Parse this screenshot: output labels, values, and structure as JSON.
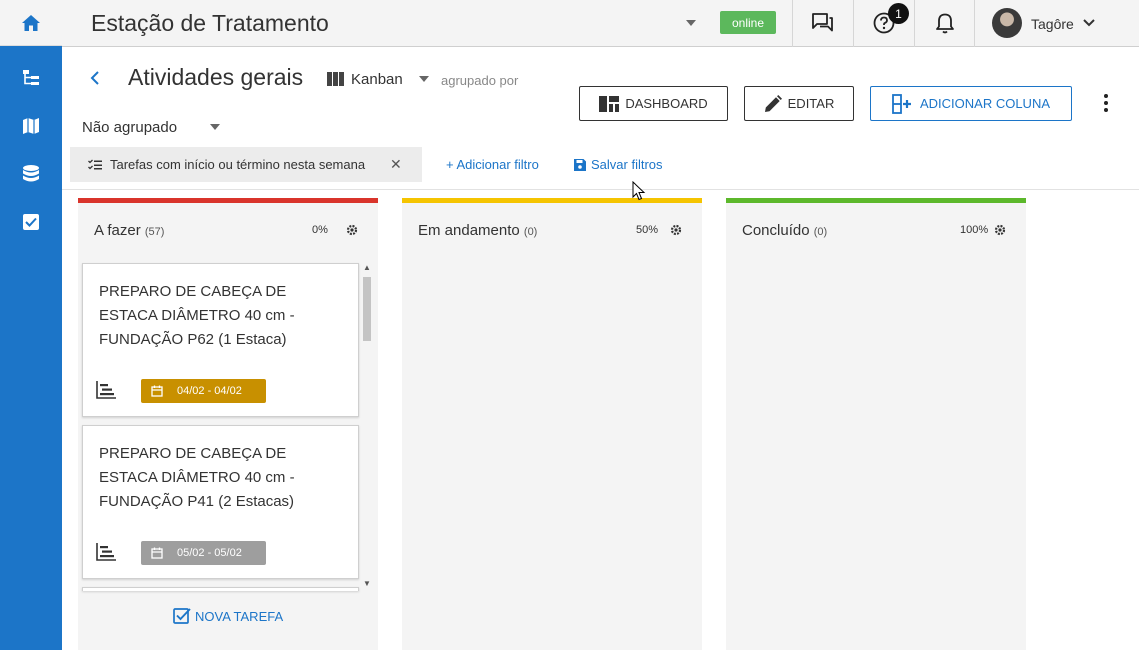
{
  "header": {
    "project_title": "Estação de Tratamento",
    "status_badge": "online",
    "notifications_count": "1",
    "user_name": "Tagôre"
  },
  "page": {
    "title": "Atividades gerais",
    "view_mode": "Kanban",
    "grouped_by_label": "agrupado por",
    "group_value": "Não agrupado"
  },
  "toolbar": {
    "dashboard_label": "DASHBOARD",
    "edit_label": "EDITAR",
    "add_column_label": "ADICIONAR COLUNA"
  },
  "filters": {
    "active_filter": "Tarefas com início ou término nesta semana",
    "add_filter_label": "+ Adicionar filtro",
    "save_filters_label": "Salvar filtros"
  },
  "columns": [
    {
      "title": "A fazer",
      "count": "(57)",
      "percent": "0%",
      "color": "#d9342b",
      "cards": [
        {
          "title": "PREPARO DE CABEÇA DE ESTACA DIÂMETRO 40 cm - FUNDAÇÃO P62 (1 Estaca)",
          "dates": "04/02 - 04/02",
          "badge_color": "#c89000"
        },
        {
          "title": "PREPARO DE CABEÇA DE ESTACA DIÂMETRO 40 cm - FUNDAÇÃO P41 (2 Estacas)",
          "dates": "05/02 - 05/02",
          "badge_color": "#9e9e9e"
        }
      ],
      "new_task_label": "NOVA TAREFA"
    },
    {
      "title": "Em andamento",
      "count": "(0)",
      "percent": "50%",
      "color": "#f5c400"
    },
    {
      "title": "Concluído",
      "count": "(0)",
      "percent": "100%",
      "color": "#5cb82b"
    }
  ],
  "colors": {
    "accent": "#1c75c8",
    "sidebar": "#1c75c8",
    "online": "#5cb85c"
  },
  "icons": [
    "home-icon",
    "tree-icon",
    "map-icon",
    "database-icon",
    "checkbox-icon",
    "chat-icon",
    "help-icon",
    "bell-icon",
    "gear-icon",
    "calendar-icon",
    "gantt-icon",
    "save-icon",
    "kebab-icon"
  ]
}
